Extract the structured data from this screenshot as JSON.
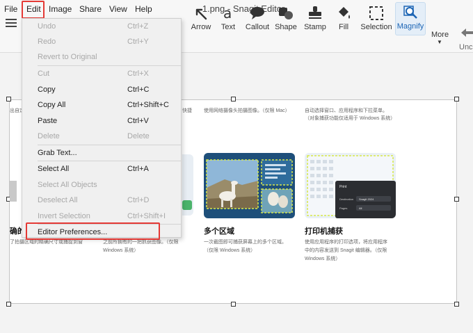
{
  "menubar": {
    "items": [
      "File",
      "Edit",
      "Image",
      "Share",
      "View",
      "Help"
    ]
  },
  "window": {
    "title": "1.png - Snagit Editor"
  },
  "toolbar": {
    "tools": [
      {
        "label": "Arrow",
        "icon": "arrow-icon"
      },
      {
        "label": "Text",
        "icon": "text-icon"
      },
      {
        "label": "Callout",
        "icon": "callout-icon"
      },
      {
        "label": "Shape",
        "icon": "shape-icon"
      },
      {
        "label": "Stamp",
        "icon": "stamp-icon"
      },
      {
        "label": "Fill",
        "icon": "fill-icon"
      },
      {
        "label": "Selection",
        "icon": "selection-icon"
      },
      {
        "label": "Magnify",
        "icon": "magnify-icon"
      }
    ],
    "more_label": "More",
    "undo_label": "Unc"
  },
  "edit_menu": {
    "items": [
      {
        "label": "Undo",
        "shortcut": "Ctrl+Z",
        "enabled": false
      },
      {
        "label": "Redo",
        "shortcut": "Ctrl+Y",
        "enabled": false
      },
      {
        "label": "Revert to Original",
        "shortcut": "",
        "enabled": false
      },
      {
        "label": "Cut",
        "shortcut": "Ctrl+X",
        "enabled": false
      },
      {
        "label": "Copy",
        "shortcut": "Ctrl+C",
        "enabled": true
      },
      {
        "label": "Copy All",
        "shortcut": "Ctrl+Shift+C",
        "enabled": true
      },
      {
        "label": "Paste",
        "shortcut": "Ctrl+V",
        "enabled": true
      },
      {
        "label": "Delete",
        "shortcut": "Delete",
        "enabled": false
      },
      {
        "label": "Grab Text...",
        "shortcut": "",
        "enabled": true
      },
      {
        "label": "Select All",
        "shortcut": "Ctrl+A",
        "enabled": true
      },
      {
        "label": "Select All Objects",
        "shortcut": "",
        "enabled": false
      },
      {
        "label": "Deselect All",
        "shortcut": "Ctrl+D",
        "enabled": false
      },
      {
        "label": "Invert Selection",
        "shortcut": "Ctrl+Shift+I",
        "enabled": false
      },
      {
        "label": "Editor Preferences...",
        "shortcut": "",
        "enabled": true
      }
    ]
  },
  "image": {
    "captions": {
      "top_left": "出自定",
      "top_mid_left": "快捷",
      "top_mid": "使用网络摄像头拍摄图像。（仅限 Mac）",
      "top_right_1": "自动选择窗口、应用程序和下拉菜单。",
      "top_right_2": "（对象捕获功能仅适用于 Windows 系统）",
      "left_title": "确的",
      "left_cap": "了拍摄区域的精确尺寸或捕捉到窗",
      "midleft_cap_1": "之前所拥有的一把抓获图像。（仅限",
      "midleft_cap_2": "Windows 系统）",
      "mid_title": "多个区域",
      "mid_cap_1": "一次截图即可捕获屏幕上的多个区域。",
      "mid_cap_2": "（仅限 Windows 系统）",
      "right_title": "打印机捕获",
      "right_cap_1": "使用应用程序的打印选项，将应用程序",
      "right_cap_2": "中的内容发送到 Snagit 编辑器。（仅限",
      "right_cap_3": "Windows 系统）"
    },
    "printer_thumb": {
      "label_print": "Print",
      "label_destination": "Destination",
      "value_destination": "Snagit 2024",
      "label_pages": "Pages",
      "value_pages": "All"
    }
  }
}
